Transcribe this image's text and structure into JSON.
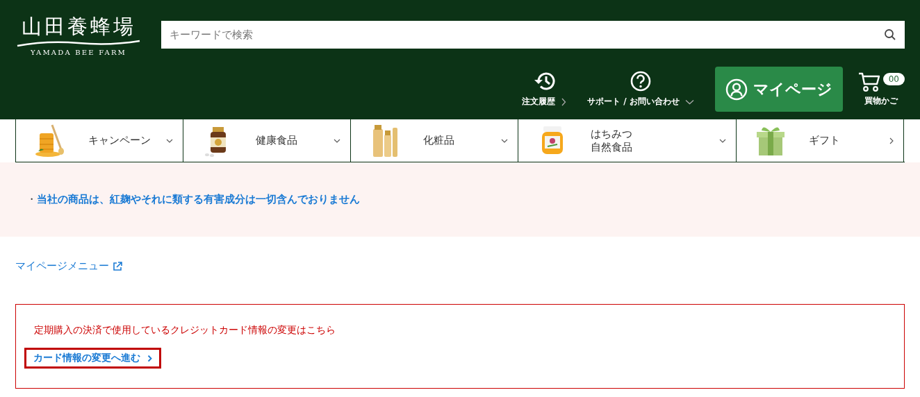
{
  "logo": {
    "name": "山田養蜂場",
    "subtitle": "YAMADA BEE FARM"
  },
  "search": {
    "placeholder": "キーワードで検索"
  },
  "header_links": [
    {
      "label": "注文履歴",
      "kind": "history",
      "expandable": false
    },
    {
      "label": "サポート / お問い合わせ",
      "kind": "help",
      "expandable": true
    }
  ],
  "mypage_button": {
    "label": "マイページ"
  },
  "cart": {
    "label": "買物かご",
    "count": "00"
  },
  "categories": [
    {
      "lines": [
        "キャンペーン"
      ],
      "expandable": true,
      "kind": "honeycomb"
    },
    {
      "lines": [
        "健康食品"
      ],
      "expandable": true,
      "kind": "bottle"
    },
    {
      "lines": [
        "化粧品"
      ],
      "expandable": true,
      "kind": "cosmetics"
    },
    {
      "lines": [
        "はちみつ",
        "自然食品"
      ],
      "expandable": true,
      "kind": "jar"
    },
    {
      "lines": [
        "ギフト"
      ],
      "expandable": false,
      "kind": "gift"
    }
  ],
  "notice": {
    "bullet": "・",
    "text": "当社の商品は、紅麹やそれに類する有害成分は一切含んでおりません"
  },
  "mypage_menu_link": {
    "label": "マイページメニュー"
  },
  "card_notice": {
    "text": "定期購入の決済で使用しているクレジットカード情報の変更はこちら",
    "link": "カード情報の変更へ進む"
  }
}
